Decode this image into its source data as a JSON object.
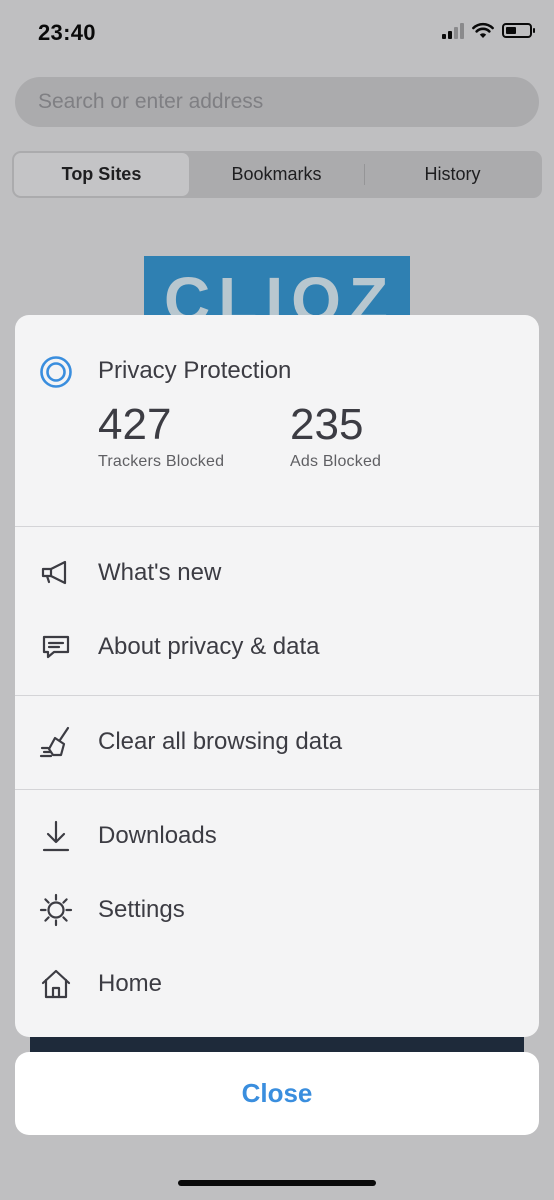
{
  "status_bar": {
    "time": "23:40",
    "icons": [
      "cellular-signal-icon",
      "wifi-icon",
      "battery-icon"
    ]
  },
  "browser": {
    "search_placeholder": "Search or enter address",
    "tabs": [
      {
        "label": "Top Sites",
        "selected": true
      },
      {
        "label": "Bookmarks",
        "selected": false
      },
      {
        "label": "History",
        "selected": false
      }
    ],
    "logo_text": "CLIQZ"
  },
  "menu": {
    "privacy": {
      "title": "Privacy Protection",
      "trackers_blocked_value": "427",
      "trackers_blocked_label": "Trackers Blocked",
      "ads_blocked_value": "235",
      "ads_blocked_label": "Ads Blocked"
    },
    "items": [
      {
        "label": "What's new",
        "icon": "megaphone-icon"
      },
      {
        "label": "About privacy & data",
        "icon": "message-icon"
      },
      {
        "label": "Clear all browsing data",
        "icon": "broom-icon"
      },
      {
        "label": "Downloads",
        "icon": "download-icon"
      },
      {
        "label": "Settings",
        "icon": "gear-icon"
      },
      {
        "label": "Home",
        "icon": "home-icon"
      }
    ],
    "close_label": "Close"
  },
  "colors": {
    "accent": "#3a8ede",
    "sheet_background": "#f4f4f5",
    "text": "#3c3c43",
    "divider": "#d4d4d7"
  }
}
